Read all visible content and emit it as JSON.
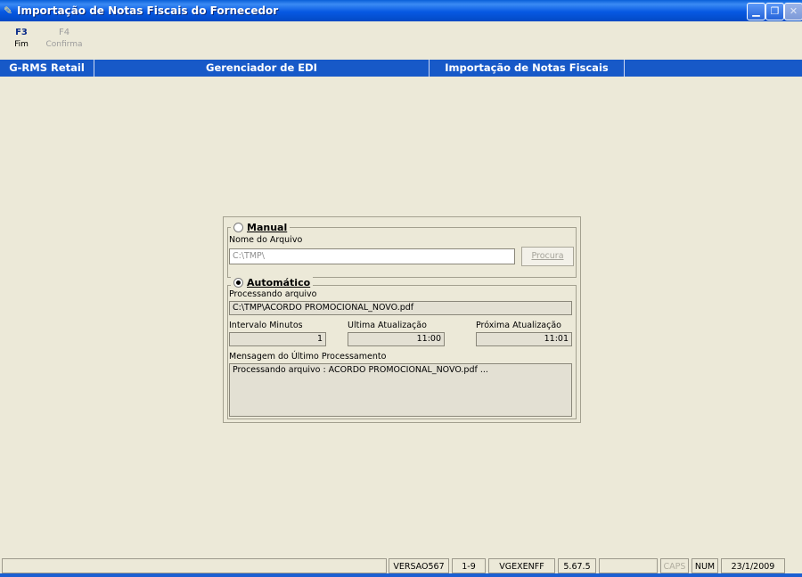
{
  "window": {
    "title": "Importação de Notas Fiscais do Fornecedor"
  },
  "toolbar": [
    {
      "key": "F3",
      "label": "Fim",
      "enabled": true
    },
    {
      "key": "F4",
      "label": "Confirma",
      "enabled": false
    }
  ],
  "header_band": [
    "G-RMS Retail",
    "Gerenciador de EDI",
    "Importação de Notas Fiscais"
  ],
  "manual": {
    "option_label": "Manual",
    "selected": false,
    "file_label": "Nome do Arquivo",
    "file_value": "C:\\TMP\\",
    "browse_label": "Procura"
  },
  "automatic": {
    "option_label": "Automático",
    "selected": true,
    "processing_label": "Processando arquivo",
    "processing_value": "C:\\TMP\\ACORDO PROMOCIONAL_NOVO.pdf",
    "interval_label": "Intervalo Minutos",
    "interval_value": "1",
    "last_update_label": "Ultima Atualização",
    "last_update_value": "11:00",
    "next_update_label": "Próxima Atualização",
    "next_update_value": "11:01",
    "message_label": "Mensagem do Último Processamento",
    "message_value": "Processando arquivo : ACORDO PROMOCIONAL_NOVO.pdf ..."
  },
  "statusbar": {
    "version": "VERSAO567",
    "page": "1-9",
    "program": "VGEXENFF",
    "build": "5.67.5",
    "caps": "CAPS",
    "num": "NUM",
    "date": "23/1/2009"
  }
}
